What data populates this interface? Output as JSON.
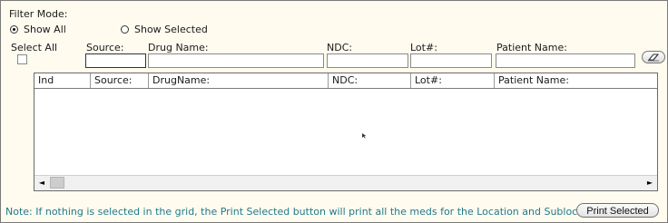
{
  "filter": {
    "title": "Filter Mode:",
    "options": [
      {
        "label": "Show All",
        "selected": true
      },
      {
        "label": "Show Selected",
        "selected": false
      }
    ]
  },
  "search": {
    "select_all_label": "Select All",
    "source_label": "Source:",
    "drug_name_label": "Drug Name:",
    "ndc_label": "NDC:",
    "lot_label": "Lot#:",
    "patient_name_label": "Patient Name:",
    "source_value": "",
    "drug_name_value": "",
    "ndc_value": "",
    "lot_value": "",
    "patient_name_value": "",
    "clear_icon": "eraser-icon"
  },
  "grid": {
    "columns": [
      "Ind",
      "Source:",
      "DrugName:",
      "NDC:",
      "Lot#:",
      "Patient Name:"
    ],
    "rows": [],
    "scroll_left_icon": "◄",
    "scroll_right_icon": "►"
  },
  "footer": {
    "note": "Note: If nothing is selected in the grid, the Print Selected button will print all the meds for the Location and Sublocation",
    "print_button": "Print Selected"
  },
  "colors": {
    "background": "#fffbef",
    "note_text": "#1f7a8c"
  }
}
